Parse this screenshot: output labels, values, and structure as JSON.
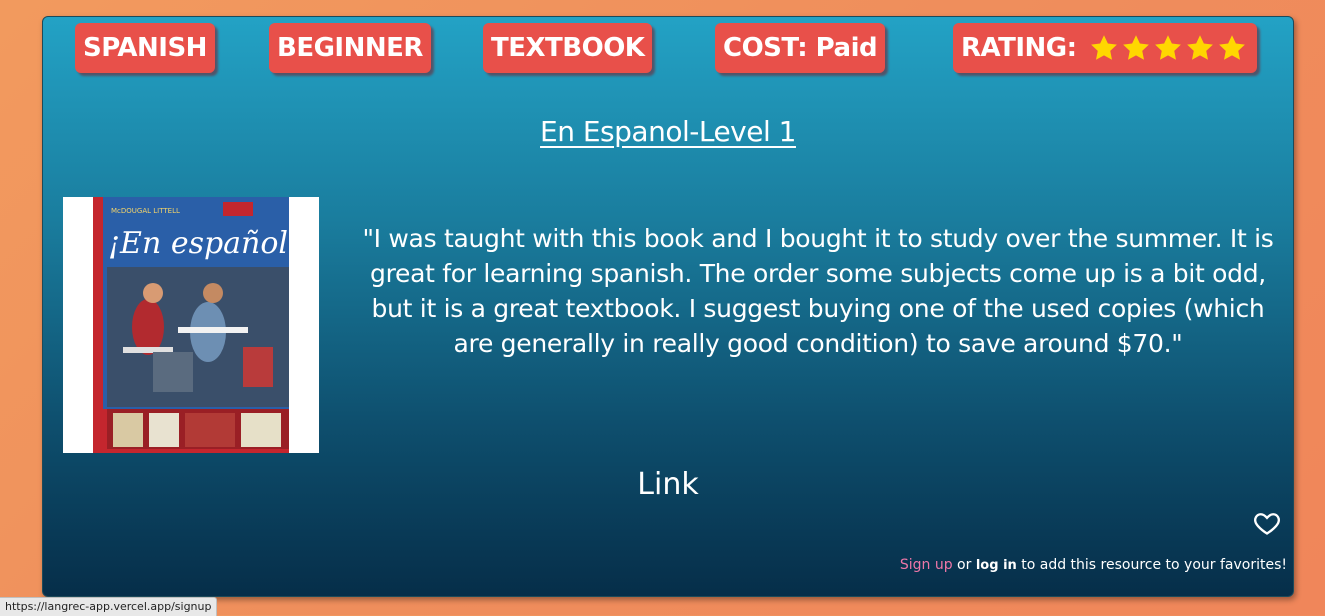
{
  "tags": {
    "language": "SPANISH",
    "level": "BEGINNER",
    "type": "TEXTBOOK",
    "cost": "COST: Paid",
    "rating_label": "RATING:",
    "rating_value": 5,
    "rating_max": 5
  },
  "resource": {
    "title": "En Espanol-Level 1",
    "cover_alt": "¡En español! book cover",
    "cover_text": "¡En español!",
    "review": "\"I was taught with this book and I bought it to study over the summer. It is great for learning spanish. The order some subjects come up is a bit odd, but it is a great textbook. I suggest buying one of the used copies (which are generally in really good condition) to save around $70.\"",
    "link_label": "Link"
  },
  "favorites": {
    "signup_label": "Sign up",
    "or_text": " or ",
    "login_label": "log in",
    "suffix_text": " to add this resource to your favorites!"
  },
  "statusbar": {
    "url": "https://langrec-app.vercel.app/signup"
  },
  "colors": {
    "page_bg": "#f0905c",
    "tag_bg": "#e8504a",
    "star": "#ffd700",
    "signup_link": "#ee77a8"
  },
  "icons": {
    "rating": "star-icon",
    "favorite": "heart-outline-icon"
  }
}
